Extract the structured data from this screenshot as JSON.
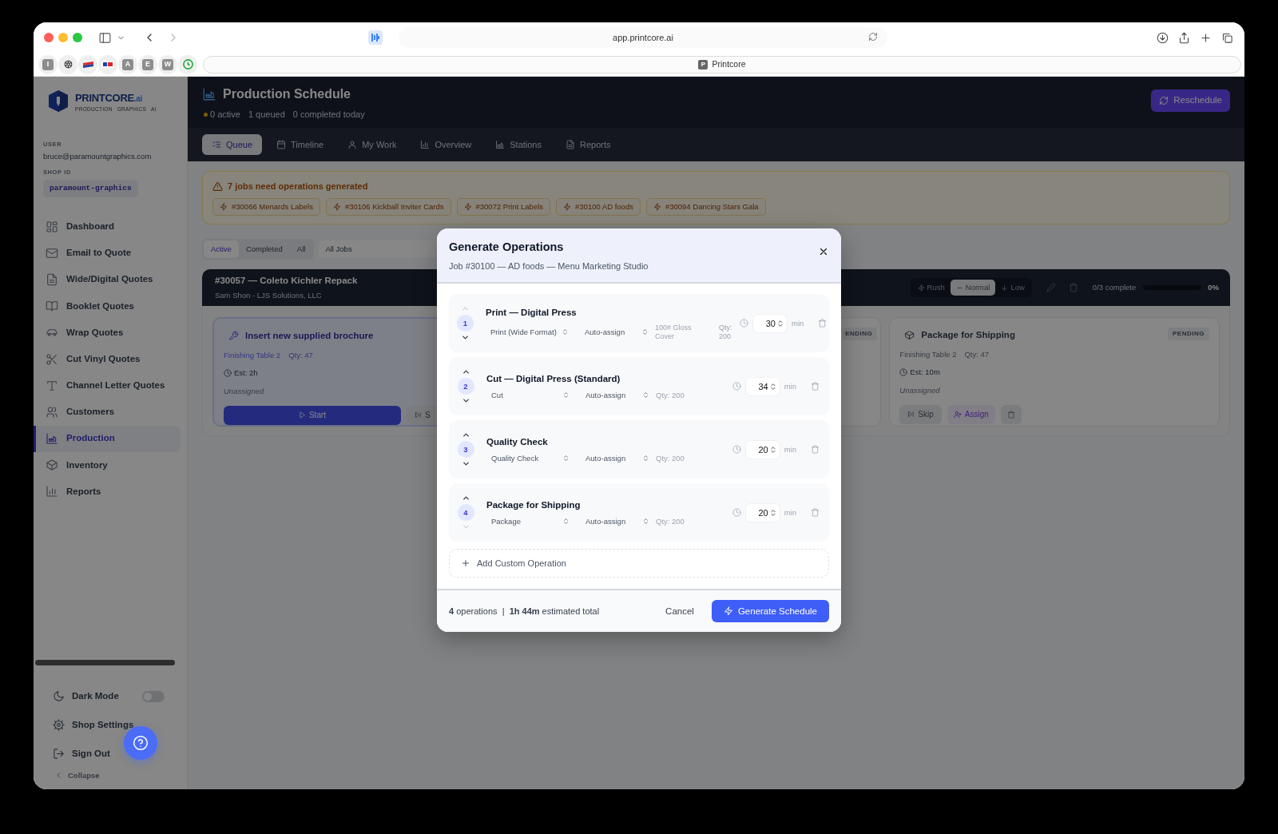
{
  "browser": {
    "url": "app.printcore.ai",
    "pinned_tabs": [
      {
        "kind": "letter",
        "label": "I"
      },
      {
        "kind": "icon"
      },
      {
        "kind": "icon"
      },
      {
        "kind": "icon"
      },
      {
        "kind": "letter",
        "label": "A"
      },
      {
        "kind": "letter",
        "label": "E"
      },
      {
        "kind": "letter",
        "label": "W"
      },
      {
        "kind": "icon"
      }
    ],
    "tab": {
      "favicon": "P",
      "title": "Printcore"
    }
  },
  "sidebar": {
    "brand": "PRINTCORE",
    "brand_suffix": ".ai",
    "tagline": [
      "PRODUCTION",
      "GRAPHICS",
      "AI"
    ],
    "user_label": "USER",
    "user": "bruce@paramountgraphics.com",
    "shop_label": "SHOP ID",
    "shop_id": "paramount-graphics",
    "items": [
      {
        "label": "Dashboard",
        "selected": false
      },
      {
        "label": "Email to Quote",
        "selected": false
      },
      {
        "label": "Wide/Digital Quotes",
        "selected": false
      },
      {
        "label": "Booklet Quotes",
        "selected": false
      },
      {
        "label": "Wrap Quotes",
        "selected": false
      },
      {
        "label": "Cut Vinyl Quotes",
        "selected": false
      },
      {
        "label": "Channel Letter Quotes",
        "selected": false
      },
      {
        "label": "Customers",
        "selected": false
      },
      {
        "label": "Production",
        "selected": true
      },
      {
        "label": "Inventory",
        "selected": false
      },
      {
        "label": "Reports",
        "selected": false
      }
    ],
    "dark_mode": {
      "label": "Dark Mode",
      "on": false
    },
    "footer_items": [
      "Shop Settings",
      "Sign Out"
    ],
    "collapse": "Collapse"
  },
  "header": {
    "title": "Production Schedule",
    "stats": [
      "0 active",
      "1 queued",
      "0 completed today"
    ],
    "reschedule": "Reschedule",
    "tabs": [
      {
        "label": "Queue",
        "selected": true
      },
      {
        "label": "Timeline",
        "selected": false
      },
      {
        "label": "My Work",
        "selected": false
      },
      {
        "label": "Overview",
        "selected": false
      },
      {
        "label": "Stations",
        "selected": false
      },
      {
        "label": "Reports",
        "selected": false
      }
    ]
  },
  "alert": {
    "message": "7 jobs need operations generated",
    "jobs": [
      "#30066 Menards Labels",
      "#30106 Kickball Inviter Cards",
      "#30072 Print Labels",
      "#30100 AD foods",
      "#30094 Dancing Stars Gala"
    ]
  },
  "filters": {
    "segments": [
      {
        "label": "Active",
        "selected": true
      },
      {
        "label": "Completed",
        "selected": false
      },
      {
        "label": "All",
        "selected": false
      }
    ],
    "job_select": "All Jobs"
  },
  "job": {
    "title": "#30057 — Coleto Kichler Repack",
    "customer": "Sam Shon - LJS Solutions, LLC",
    "priorities": [
      {
        "label": "Rush",
        "selected": false
      },
      {
        "label": "Normal",
        "selected": true
      },
      {
        "label": "Low",
        "selected": false
      }
    ],
    "progress_text": "0/3 complete",
    "level": 0,
    "percent": "0%",
    "operations": [
      {
        "kind": "active",
        "title": "Insert new supplied brochure",
        "station": "Finishing Table 2",
        "qty": "Qty: 47",
        "estimate": "Est: 2h",
        "assignee": "Unassigned",
        "start": "Start",
        "skip": "S"
      },
      {
        "kind": "covered",
        "status": "ENDING"
      },
      {
        "kind": "pending",
        "title": "Package for Shipping",
        "status": "PENDING",
        "station": "Finishing Table 2",
        "qty": "Qty: 47",
        "estimate": "Est: 10m",
        "assignee": "Unassigned",
        "skip": "Skip",
        "assign": "Assign"
      }
    ]
  },
  "modal": {
    "title": "Generate Operations",
    "subtitle": "Job #30100 — AD foods — Menu Marketing Studio",
    "operations": [
      {
        "number": "1",
        "name": "Print — Digital Press",
        "type": "Print (Wide Format)",
        "assignee": "Auto-assign",
        "material": "100# Gloss Cover",
        "qty": "Qty: 200",
        "minutes": "30",
        "unit": "min",
        "up_disabled": true,
        "down_disabled": false
      },
      {
        "number": "2",
        "name": "Cut — Digital Press (Standard)",
        "type": "Cut",
        "assignee": "Auto-assign",
        "qty": "Qty: 200",
        "minutes": "34",
        "unit": "min",
        "up_disabled": false,
        "down_disabled": false
      },
      {
        "number": "3",
        "name": "Quality Check",
        "type": "Quality Check",
        "assignee": "Auto-assign",
        "qty": "Qty: 200",
        "minutes": "20",
        "unit": "min",
        "up_disabled": false,
        "down_disabled": false
      },
      {
        "number": "4",
        "name": "Package for Shipping",
        "type": "Package",
        "assignee": "Auto-assign",
        "qty": "Qty: 200",
        "minutes": "20",
        "unit": "min",
        "up_disabled": false,
        "down_disabled": true
      }
    ],
    "add": "Add Custom Operation",
    "summary": "**4** operations  |  **1h 44m** estimated total",
    "cancel": "Cancel",
    "submit": "Generate Schedule"
  }
}
